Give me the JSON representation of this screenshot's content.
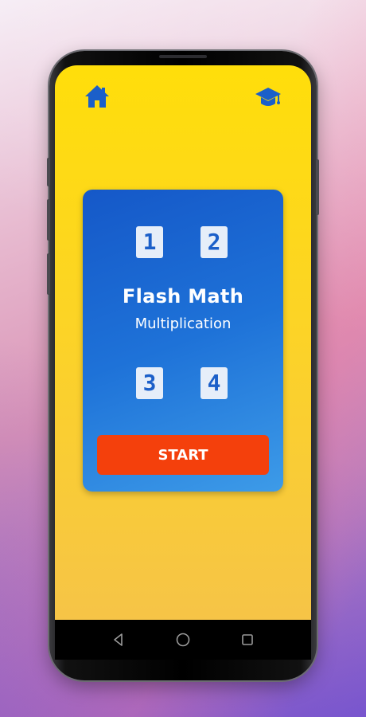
{
  "app": {
    "title": "Flash Math",
    "subtitle": "Multiplication"
  },
  "top_bar": {
    "left_icon": "home-icon",
    "right_icon": "graduation-cap-icon"
  },
  "card": {
    "numbers": [
      "1",
      "2",
      "3",
      "4"
    ]
  },
  "start_label": "START",
  "nav_bar": {
    "icons": [
      "back-icon",
      "home-circle-icon",
      "recent-apps-icon"
    ]
  },
  "colors": {
    "screen_top": "#ffde0a",
    "screen_bottom": "#f6c447",
    "icon_blue": "#1b5fc9",
    "card_start": "#1558c8",
    "card_end": "#3d9be8",
    "start_button": "#f4400c"
  }
}
